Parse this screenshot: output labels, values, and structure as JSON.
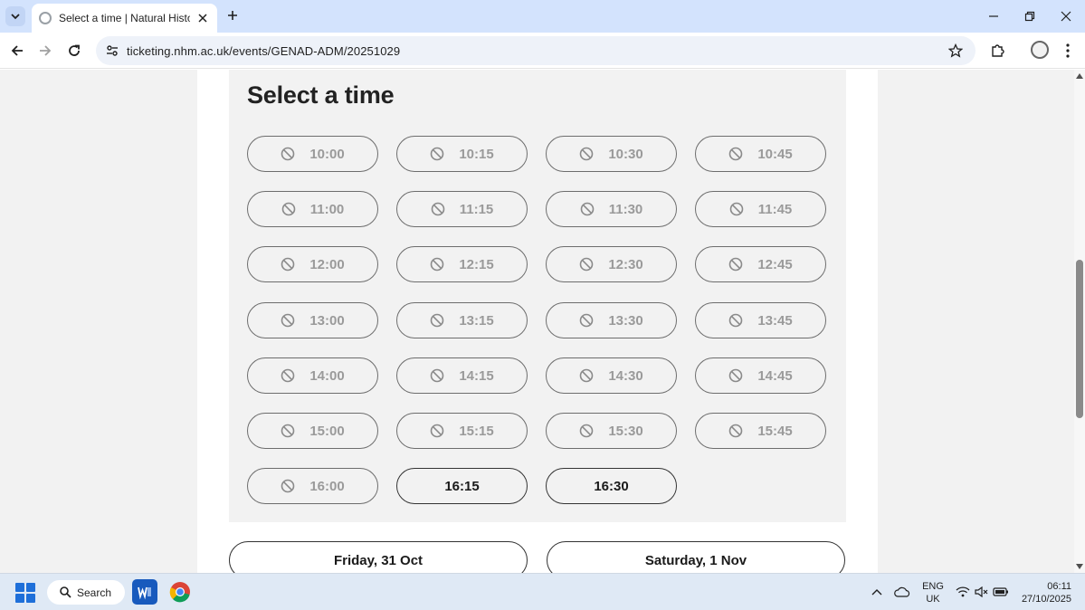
{
  "browser": {
    "tab_title": "Select a time | Natural History M",
    "url": "ticketing.nhm.ac.uk/events/GENAD-ADM/20251029"
  },
  "page": {
    "title": "Select a time",
    "slots": [
      {
        "time": "10:00",
        "available": false
      },
      {
        "time": "10:15",
        "available": false
      },
      {
        "time": "10:30",
        "available": false
      },
      {
        "time": "10:45",
        "available": false
      },
      {
        "time": "11:00",
        "available": false
      },
      {
        "time": "11:15",
        "available": false
      },
      {
        "time": "11:30",
        "available": false
      },
      {
        "time": "11:45",
        "available": false
      },
      {
        "time": "12:00",
        "available": false
      },
      {
        "time": "12:15",
        "available": false
      },
      {
        "time": "12:30",
        "available": false
      },
      {
        "time": "12:45",
        "available": false
      },
      {
        "time": "13:00",
        "available": false
      },
      {
        "time": "13:15",
        "available": false
      },
      {
        "time": "13:30",
        "available": false
      },
      {
        "time": "13:45",
        "available": false
      },
      {
        "time": "14:00",
        "available": false
      },
      {
        "time": "14:15",
        "available": false
      },
      {
        "time": "14:30",
        "available": false
      },
      {
        "time": "14:45",
        "available": false
      },
      {
        "time": "15:00",
        "available": false
      },
      {
        "time": "15:15",
        "available": false
      },
      {
        "time": "15:30",
        "available": false
      },
      {
        "time": "15:45",
        "available": false
      },
      {
        "time": "16:00",
        "available": false
      },
      {
        "time": "16:15",
        "available": true
      },
      {
        "time": "16:30",
        "available": true
      }
    ],
    "days": [
      "Friday, 31 Oct",
      "Saturday, 1 Nov"
    ]
  },
  "taskbar": {
    "search_label": "Search",
    "lang_line1": "ENG",
    "lang_line2": "UK",
    "time": "06:11",
    "date": "27/10/2025"
  },
  "colors": {
    "tabbar": "#d3e3fd",
    "panel": "#f2f2f2",
    "unavailable_text": "#9a9a9a",
    "available_text": "#1a1a1a"
  }
}
